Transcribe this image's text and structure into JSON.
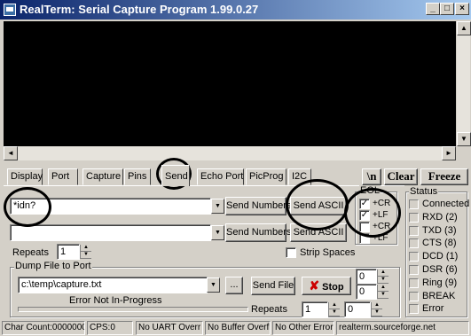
{
  "window": {
    "title": "RealTerm: Serial Capture Program 1.99.0.27",
    "minimize": "_",
    "maximize": "□",
    "close": "×"
  },
  "tabs": [
    "Display",
    "Port",
    "Capture",
    "Pins",
    "Send",
    "Echo Port",
    "PicProg",
    "I2C"
  ],
  "active_tab": "Send",
  "toolbar": {
    "newline_label": "\\n",
    "clear_label": "Clear",
    "freeze_label": "Freeze"
  },
  "send": {
    "input1_value": "*idn?",
    "input2_value": "",
    "send_numbers_1": "Send Numbers",
    "send_ascii_1": "Send ASCII",
    "send_numbers_2": "Send Numbers",
    "send_ascii_2": "Send ASCII",
    "repeats_label": "Repeats",
    "repeats_value": "1",
    "strip_spaces_label": "Strip Spaces"
  },
  "eol": {
    "label": "EOL",
    "items": [
      {
        "label": "+CR",
        "checked": true
      },
      {
        "label": "+LF",
        "checked": true
      },
      {
        "label": "+CR",
        "checked": false
      },
      {
        "label": "+LF",
        "checked": false
      }
    ]
  },
  "dump": {
    "label": "Dump File to Port",
    "file_value": "c:\\temp\\capture.txt",
    "browse_label": "...",
    "send_file_label": "Send File",
    "stop_label": "Stop",
    "status_text": "Error Not In-Progress",
    "repeats_label": "Repeats",
    "repeats_value": "1",
    "repeats_value2": "0",
    "delay_value1": "0",
    "delay_value2": "0"
  },
  "status": {
    "label": "Status",
    "items": [
      "Connected",
      "RXD (2)",
      "TXD (3)",
      "CTS (8)",
      "DCD (1)",
      "DSR (6)",
      "Ring (9)",
      "BREAK",
      "Error"
    ]
  },
  "statusbar": {
    "char_count": "Char Count:0000000",
    "cps": "CPS:0",
    "uart": "No UART Overr",
    "buffer": "No Buffer Overfl",
    "other": "No Other Errors",
    "site": "realterm.sourceforge.net"
  },
  "colors": {
    "titlebar_start": "#0a246a",
    "titlebar_end": "#a6caf0",
    "face": "#d4d0c8",
    "terminal": "#000000",
    "stop_icon": "#cc0000"
  }
}
